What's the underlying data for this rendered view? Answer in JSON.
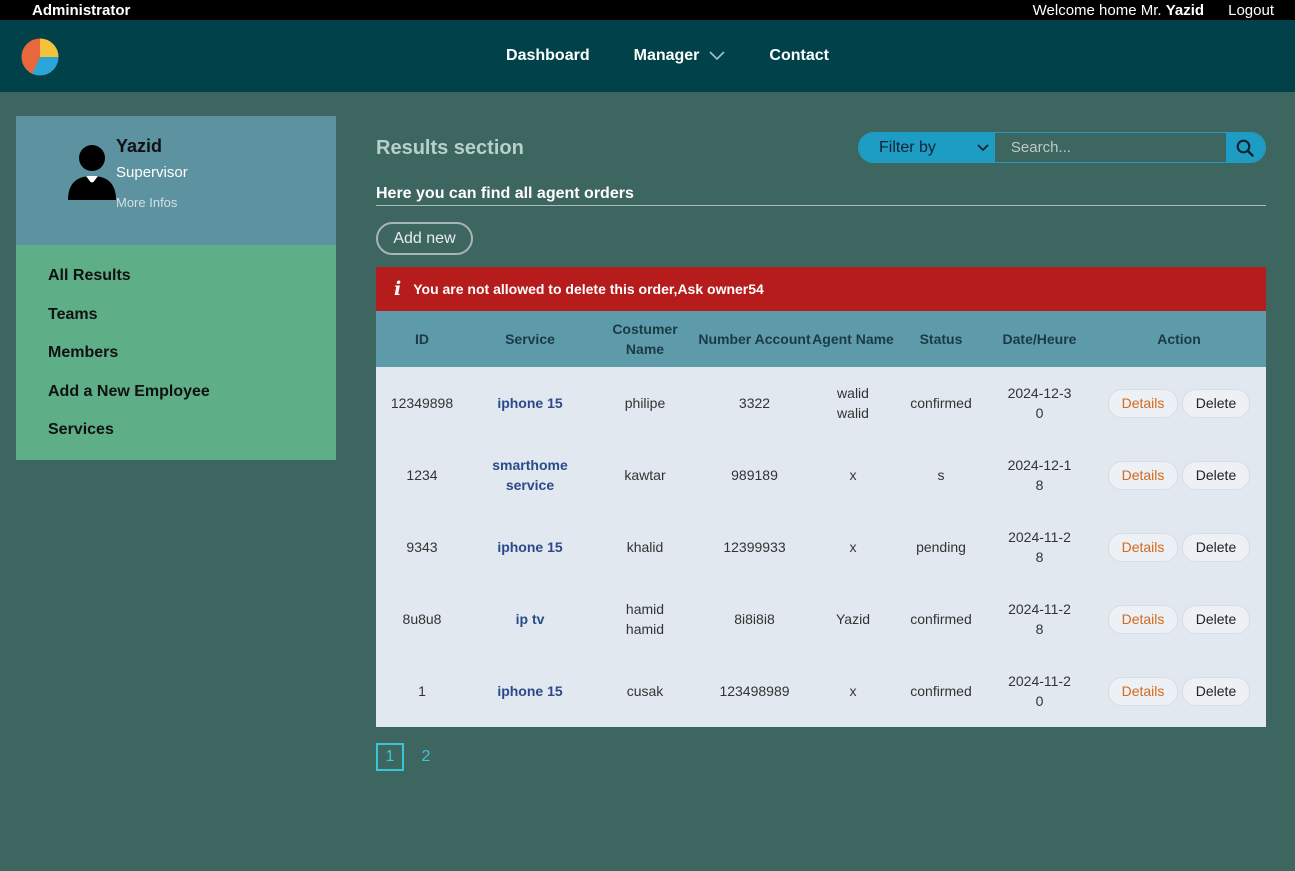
{
  "topbar": {
    "role": "Administrator",
    "welcome_prefix": "Welcome home Mr.",
    "welcome_name": "Yazid",
    "logout": "Logout"
  },
  "nav": {
    "items": [
      {
        "label": "Dashboard"
      },
      {
        "label": "Manager"
      },
      {
        "label": "Contact"
      }
    ]
  },
  "profile": {
    "name": "Yazid",
    "role": "Supervisor",
    "more": "More Infos"
  },
  "sidebar": {
    "items": [
      {
        "label": "All Results"
      },
      {
        "label": "Teams"
      },
      {
        "label": "Members"
      },
      {
        "label": "Add a New Employee"
      },
      {
        "label": "Services"
      }
    ]
  },
  "main": {
    "title": "Results section",
    "subtitle": "Here you can find all agent orders",
    "add_button": "Add new",
    "filter_label": "Filter by",
    "search_placeholder": "Search...",
    "alert": "You are not allowed to delete this order,Ask owner54"
  },
  "table": {
    "headers": {
      "id": "ID",
      "service": "Service",
      "customer": "Costumer Name",
      "account": "Number Account",
      "agent": "Agent Name",
      "status": "Status",
      "date": "Date/Heure",
      "action": "Action"
    },
    "details_label": "Details",
    "delete_label": "Delete",
    "rows": [
      {
        "id": "12349898",
        "service": "iphone 15",
        "customer": "philipe",
        "account": "3322",
        "agent": "walid walid",
        "status": "confirmed",
        "date": "2024-12-30"
      },
      {
        "id": "1234",
        "service": "smarthome service",
        "customer": "kawtar",
        "account": "989189",
        "agent": "x",
        "status": "s",
        "date": "2024-12-18"
      },
      {
        "id": "9343",
        "service": "iphone 15",
        "customer": "khalid",
        "account": "12399933",
        "agent": "x",
        "status": "pending",
        "date": "2024-11-28"
      },
      {
        "id": "8u8u8",
        "service": "ip tv",
        "customer": "hamid hamid",
        "account": "8i8i8i8",
        "agent": "Yazid",
        "status": "confirmed",
        "date": "2024-11-28"
      },
      {
        "id": "1",
        "service": "iphone 15",
        "customer": "cusak",
        "account": "123498989",
        "agent": "x",
        "status": "confirmed",
        "date": "2024-11-20"
      }
    ]
  },
  "pagination": {
    "pages": [
      "1",
      "2"
    ],
    "active": "1"
  },
  "colors": {
    "background": "#3e6660",
    "navbar": "#01424a",
    "profile": "#5d92a0",
    "sidemenu": "#5eae87",
    "alert": "#b71c1c",
    "accent": "#1e9dc4"
  }
}
